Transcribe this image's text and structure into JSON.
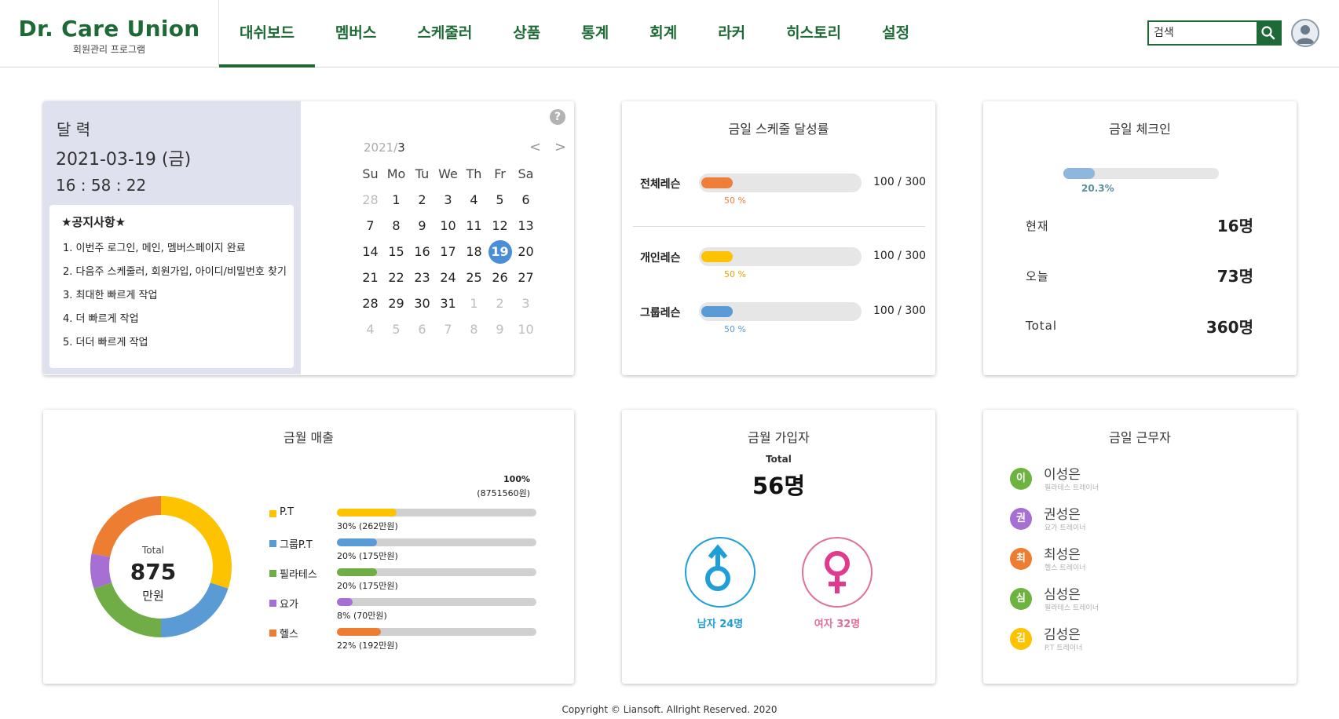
{
  "header": {
    "logo_title": "Dr. Care Union",
    "logo_subtitle": "회원관리 프로그램",
    "nav": [
      {
        "label": "대쉬보드",
        "active": true
      },
      {
        "label": "멤버스",
        "active": false
      },
      {
        "label": "스케줄러",
        "active": false
      },
      {
        "label": "상품",
        "active": false
      },
      {
        "label": "통계",
        "active": false
      },
      {
        "label": "회계",
        "active": false
      },
      {
        "label": "라커",
        "active": false
      },
      {
        "label": "히스토리",
        "active": false
      },
      {
        "label": "설정",
        "active": false
      }
    ],
    "search_placeholder": "검색",
    "search_icon": "search-icon",
    "avatar_icon": "user-avatar-icon"
  },
  "calendar_card": {
    "label": "달 력",
    "date": "2021-03-19 (금)",
    "time": "16 : 58 : 22",
    "notice_title": "★공지사항★",
    "notices": [
      "1. 이번주 로그인, 메인, 멤버스페이지 완료",
      "2. 다음주 스케줄러, 회원가입, 아이디/비밀번호 찾기",
      "3. 최대한 빠르게 작업",
      "4. 더 빠르게 작업",
      "5. 더더 빠르게 작업"
    ],
    "help_icon": "?",
    "year_label": "2021/",
    "month_label": "3",
    "prev": "<",
    "next": ">",
    "weekdays": [
      "Su",
      "Mo",
      "Tu",
      "We",
      "Th",
      "Fr",
      "Sa"
    ],
    "weeks": [
      [
        "28",
        "1",
        "2",
        "3",
        "4",
        "5",
        "6"
      ],
      [
        "7",
        "8",
        "9",
        "10",
        "11",
        "12",
        "13"
      ],
      [
        "14",
        "15",
        "16",
        "17",
        "18",
        "19",
        "20"
      ],
      [
        "21",
        "22",
        "23",
        "24",
        "25",
        "26",
        "27"
      ],
      [
        "28",
        "29",
        "30",
        "31",
        "1",
        "2",
        "3"
      ],
      [
        "4",
        "5",
        "6",
        "7",
        "8",
        "9",
        "10"
      ]
    ],
    "today": "19"
  },
  "schedule_card": {
    "title": "금일 스케줄 달성률",
    "rows": [
      {
        "label": "전체레슨",
        "fraction": 0.5,
        "pct_text": "50 %",
        "count": "100 / 300",
        "color": "#ee7f3a"
      },
      {
        "label": "개인레슨",
        "fraction": 0.5,
        "pct_text": "50 %",
        "count": "100 / 300",
        "color": "#fdc200"
      },
      {
        "label": "그룹레슨",
        "fraction": 0.5,
        "pct_text": "50 %",
        "count": "100 / 300",
        "color": "#5b9bd5"
      }
    ]
  },
  "checkin_card": {
    "title": "금일 체크인",
    "progress_fraction": 0.203,
    "progress_text": "20.3%",
    "rows": [
      {
        "label": "현재",
        "value": "16명"
      },
      {
        "label": "오늘",
        "value": "73명"
      },
      {
        "label": "Total",
        "value": "360명"
      }
    ]
  },
  "sales_card": {
    "title": "금월 매출",
    "donut_total_label": "Total",
    "donut_value": "875",
    "donut_unit": "만원",
    "top_pct": "100%",
    "top_amount": "(8751560원)",
    "items": [
      {
        "label": "P.T",
        "percent": 30,
        "sub": "30% (262만원)",
        "color": "#fdc200"
      },
      {
        "label": "그룹P.T",
        "percent": 20,
        "sub": "20% (175만원)",
        "color": "#5b9bd5"
      },
      {
        "label": "필라테스",
        "percent": 20,
        "sub": "20% (175만원)",
        "color": "#70ad47"
      },
      {
        "label": "요가",
        "percent": 8,
        "sub": "8% (70만원)",
        "color": "#a56fd3"
      },
      {
        "label": "헬스",
        "percent": 22,
        "sub": "22% (192만원)",
        "color": "#ed7d31"
      }
    ]
  },
  "signup_card": {
    "title": "금월 가입자",
    "total_label": "Total",
    "total": "56명",
    "male_label": "남자 24명",
    "female_label": "여자 32명",
    "male_icon": "male-symbol-icon",
    "female_icon": "female-symbol-icon",
    "male_color": "#1f9ed8",
    "female_color": "#e0398d"
  },
  "staff_card": {
    "title": "금일 근무자",
    "staff": [
      {
        "initial": "이",
        "name": "이성은",
        "role": "필라테스 트레이너",
        "color": "#6db33f"
      },
      {
        "initial": "권",
        "name": "권성은",
        "role": "요가 트레이너",
        "color": "#a56fd3"
      },
      {
        "initial": "최",
        "name": "최성은",
        "role": "헬스 트레이너",
        "color": "#ed7d31"
      },
      {
        "initial": "심",
        "name": "심성은",
        "role": "필라테스 트레이너",
        "color": "#6db33f"
      },
      {
        "initial": "김",
        "name": "김성은",
        "role": "P.T 트레이너",
        "color": "#fdc200"
      }
    ]
  },
  "footer": "Copyright © Liansoft. Allright Reserved. 2020"
}
